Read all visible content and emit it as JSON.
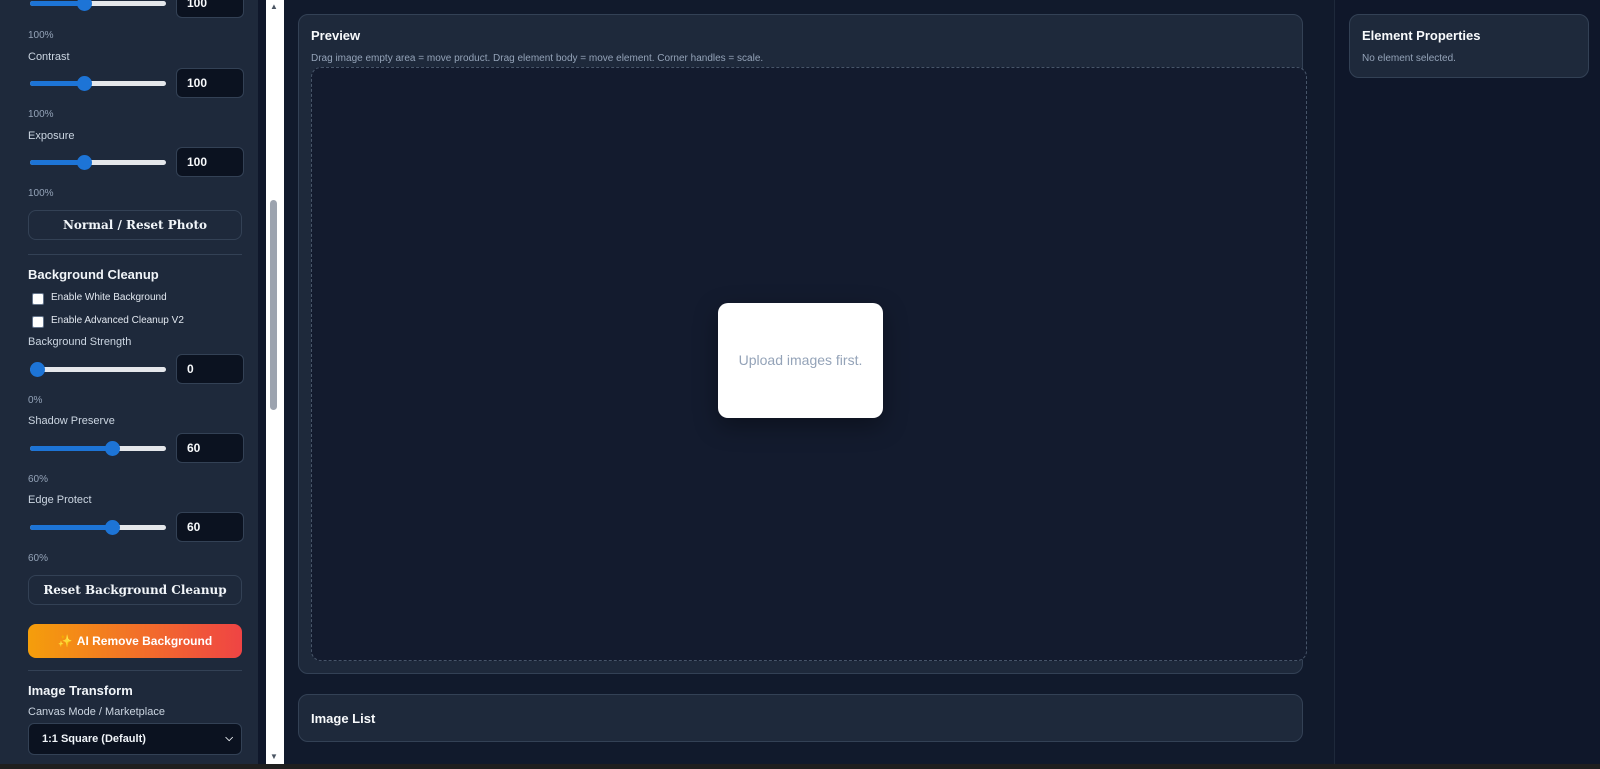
{
  "sidebar": {
    "top_slider": {
      "value": "100"
    },
    "top_pct": "100%",
    "contrast": {
      "label": "Contrast",
      "value": "100",
      "pct": "100%",
      "level": 0.4
    },
    "exposure": {
      "label": "Exposure",
      "value": "100",
      "pct": "100%",
      "level": 0.4
    },
    "reset_photo_label": "Normal / Reset Photo",
    "bg_cleanup": {
      "title": "Background Cleanup",
      "white_bg_label": "Enable White Background",
      "white_bg_checked": false,
      "advanced_label": "Enable Advanced Cleanup V2",
      "advanced_checked": false,
      "strength": {
        "label": "Background Strength",
        "value": "0",
        "pct": "0%",
        "level": 0.0
      },
      "shadow": {
        "label": "Shadow Preserve",
        "value": "60",
        "pct": "60%",
        "level": 0.6
      },
      "edge": {
        "label": "Edge Protect",
        "value": "60",
        "pct": "60%",
        "level": 0.6
      },
      "reset_label": "Reset Background Cleanup"
    },
    "ai_remove_label": "AI Remove Background",
    "transform": {
      "title": "Image Transform",
      "canvas_label": "Canvas Mode / Marketplace",
      "canvas_value": "1:1 Square (Default)"
    }
  },
  "preview": {
    "title": "Preview",
    "hint": "Drag image empty area = move product. Drag element body = move element. Corner handles = scale.",
    "placeholder": "Upload images first."
  },
  "image_list": {
    "title": "Image List"
  },
  "properties": {
    "title": "Element Properties",
    "empty": "No element selected."
  },
  "colors": {
    "accent": "#1d74d6",
    "ai_gradient_start": "#f59e0b",
    "ai_gradient_end": "#ef4444"
  }
}
